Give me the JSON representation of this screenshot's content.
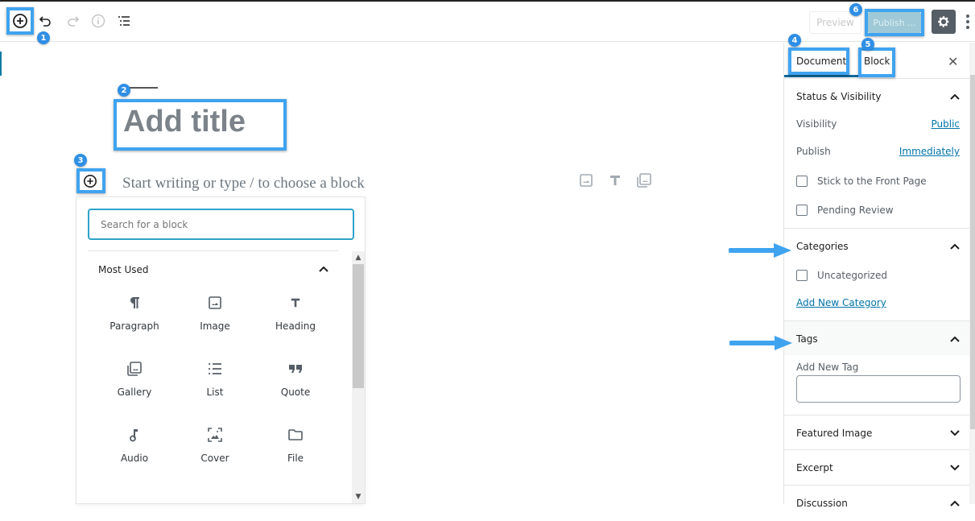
{
  "toolbar": {
    "icons": [
      "add-block-icon",
      "undo-icon",
      "redo-icon",
      "info-icon",
      "outline-list-icon"
    ],
    "preview_label": "Preview",
    "publish_label": "Publish ...",
    "settings_icon": "gear-icon",
    "more_icon": "vertical-ellipsis-icon"
  },
  "annotations": {
    "badges": [
      "1",
      "2",
      "3",
      "4",
      "5",
      "6"
    ],
    "highlight_color": "#3fa3f0",
    "badge_color": "#2f8fe6"
  },
  "editor": {
    "title_placeholder": "Add title",
    "body_placeholder": "Start writing or type / to choose a block",
    "inline_icons": [
      "image-icon",
      "heading-icon",
      "gallery-icon"
    ]
  },
  "inserter": {
    "search_placeholder": "Search for a block",
    "section_title": "Most Used",
    "blocks": [
      {
        "label": "Paragraph",
        "icon": "paragraph-icon"
      },
      {
        "label": "Image",
        "icon": "image-icon"
      },
      {
        "label": "Heading",
        "icon": "heading-icon"
      },
      {
        "label": "Gallery",
        "icon": "gallery-icon"
      },
      {
        "label": "List",
        "icon": "list-icon"
      },
      {
        "label": "Quote",
        "icon": "quote-icon"
      },
      {
        "label": "Audio",
        "icon": "audio-icon"
      },
      {
        "label": "Cover",
        "icon": "cover-icon"
      },
      {
        "label": "File",
        "icon": "folder-icon"
      }
    ]
  },
  "sidebar": {
    "tabs": [
      "Document",
      "Block"
    ],
    "active_tab": "Document",
    "status": {
      "title": "Status & Visibility",
      "visibility_label": "Visibility",
      "visibility_value": "Public",
      "publish_label": "Publish",
      "publish_value": "Immediately",
      "stick_label": "Stick to the Front Page",
      "pending_label": "Pending Review"
    },
    "categories": {
      "title": "Categories",
      "items": [
        "Uncategorized"
      ],
      "add_link": "Add New Category"
    },
    "tags": {
      "title": "Tags",
      "add_label": "Add New Tag",
      "input_value": ""
    },
    "featured_image": "Featured Image",
    "excerpt": "Excerpt",
    "discussion": "Discussion"
  }
}
